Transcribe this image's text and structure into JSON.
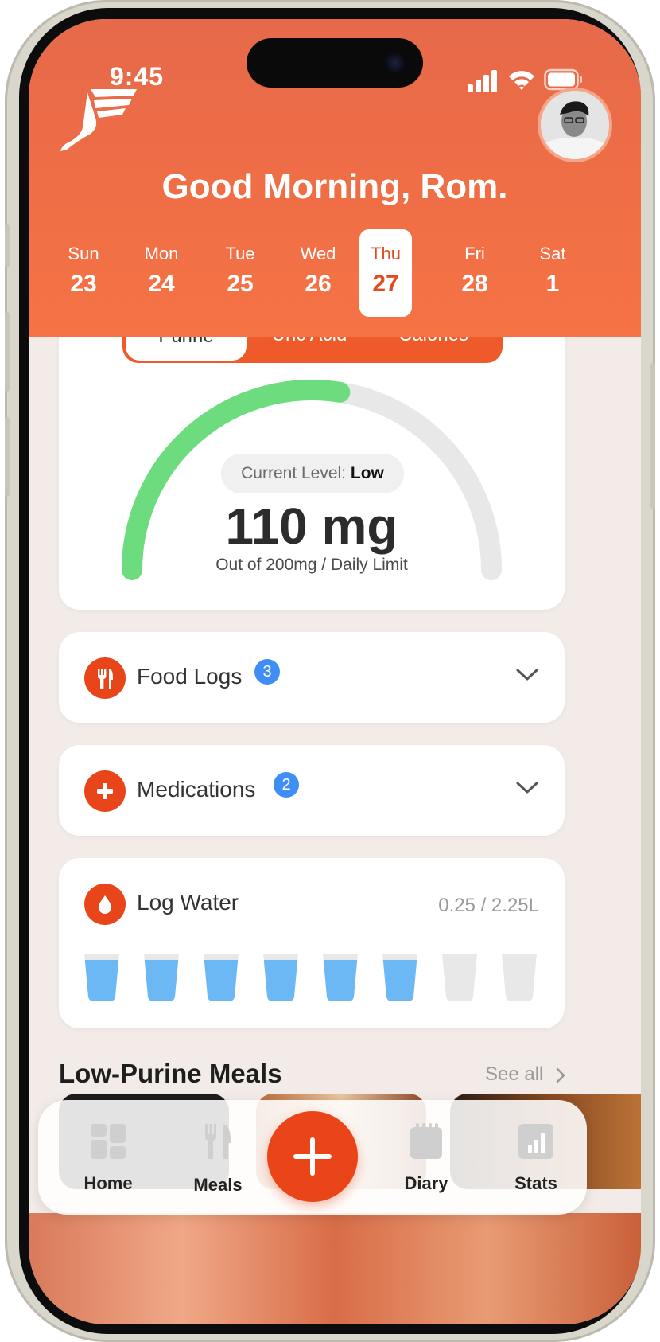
{
  "status_bar": {
    "time": "9:45"
  },
  "header": {
    "greeting": "Good Morning, Rom.",
    "days": [
      {
        "name": "Sun",
        "num": "23"
      },
      {
        "name": "Mon",
        "num": "24"
      },
      {
        "name": "Tue",
        "num": "25"
      },
      {
        "name": "Wed",
        "num": "26"
      },
      {
        "name": "Thu",
        "num": "27"
      },
      {
        "name": "Fri",
        "num": "28"
      },
      {
        "name": "Sat",
        "num": "1"
      }
    ],
    "selected_day": "Thu"
  },
  "tracker": {
    "tabs": [
      "Purine",
      "Uric Acid",
      "Calories"
    ],
    "active_tab": "Purine",
    "level_label": "Current Level:",
    "level_value": "Low",
    "value": "110 mg",
    "limit_text": "Out of 200mg / Daily Limit",
    "progress_fraction": 0.55
  },
  "food_logs": {
    "label": "Food Logs",
    "count": "3"
  },
  "medications": {
    "label": "Medications",
    "count": "2"
  },
  "water": {
    "label": "Log Water",
    "total": "0.25 / 2.25L",
    "cups_total": 8,
    "cups_filled": 6
  },
  "meals_section": {
    "title": "Low-Purine Meals",
    "see_all": "See all"
  },
  "tabbar": {
    "home": "Home",
    "meals": "Meals",
    "diary": "Diary",
    "stats": "Stats"
  },
  "colors": {
    "accent": "#ea4519",
    "gauge_fill": "#6ddc7f",
    "badge": "#3f8ef5",
    "water": "#6cb8f5"
  }
}
